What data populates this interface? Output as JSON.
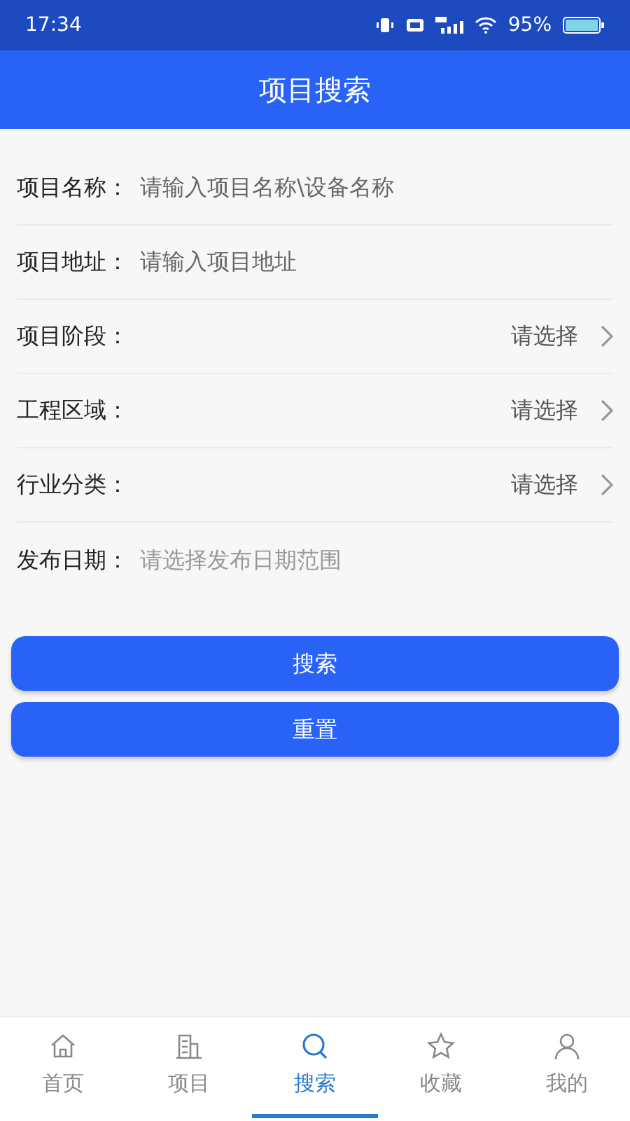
{
  "status_bar": {
    "time": "17:34",
    "battery": "95%"
  },
  "header": {
    "title": "项目搜索"
  },
  "fields": [
    {
      "kind": "input",
      "label": "项目名称：",
      "placeholder": "请输入项目名称\\设备名称"
    },
    {
      "kind": "input",
      "label": "项目地址：",
      "placeholder": "请输入项目地址"
    },
    {
      "kind": "select",
      "label": "项目阶段：",
      "value": "请选择"
    },
    {
      "kind": "select",
      "label": "工程区域：",
      "value": "请选择"
    },
    {
      "kind": "select",
      "label": "行业分类：",
      "value": "请选择"
    },
    {
      "kind": "date",
      "label": "发布日期：",
      "placeholder": "请选择发布日期范围"
    }
  ],
  "buttons": [
    "搜索",
    "重置"
  ],
  "tabs": [
    {
      "kind": "home",
      "label": "首页",
      "selected": false
    },
    {
      "kind": "building",
      "label": "项目",
      "selected": false
    },
    {
      "kind": "search",
      "label": "搜索",
      "selected": true
    },
    {
      "kind": "star",
      "label": "收藏",
      "selected": false
    },
    {
      "kind": "user",
      "label": "我的",
      "selected": false
    }
  ]
}
